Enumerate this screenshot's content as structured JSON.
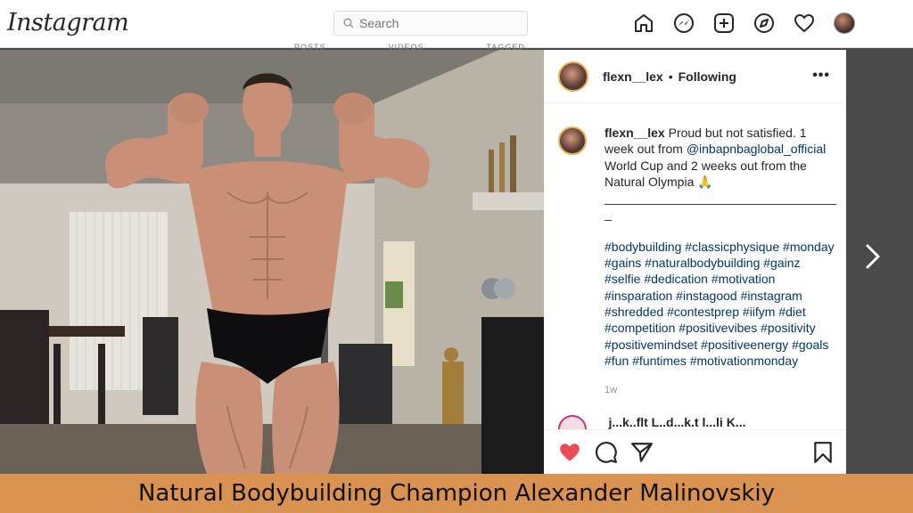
{
  "app": {
    "logo": "Instagram"
  },
  "search": {
    "placeholder": "Search"
  },
  "nav": {
    "icons": [
      "home-icon",
      "messenger-icon",
      "new-post-icon",
      "explore-icon",
      "activity-heart-icon",
      "profile-avatar"
    ]
  },
  "profile_tabs": [
    "POSTS",
    "VIDEOS",
    "TAGGED"
  ],
  "post": {
    "username": "flexn__lex",
    "separator": "•",
    "follow_status": "Following",
    "more": "•••",
    "caption_user": "flexn__lex",
    "caption_1": "Proud but not satisfied. 1 week out from ",
    "mention": "@inbapnbaglobal_official",
    "caption_2": " World Cup and 2 weeks out from the Natural Olympia 🙏",
    "divider": "____________________________________",
    "divider_end": "_",
    "hashtags": [
      "#bodybuilding",
      "#classicphysique",
      "#monday",
      "#gains",
      "#naturalbodybuilding",
      "#gainz",
      "#selfie",
      "#dedication",
      "#motivation",
      "#insparation",
      "#instagood",
      "#instagram",
      "#shredded",
      "#contestprep",
      "#iifym",
      "#diet",
      "#competition",
      "#positivevibes",
      "#positivity",
      "#positivemindset",
      "#positiveenergy",
      "#goals",
      "#fun",
      "#funtimes",
      "#motivationmonday"
    ],
    "age": "1w",
    "next_comment_preview": "j...k..flt  L..d...k.t l...li K..."
  },
  "colors": {
    "link": "#00376b",
    "like": "#ed4956",
    "banner": "#d9924f"
  },
  "banner": {
    "text": "Natural Bodybuilding Champion Alexander Malinovskiy"
  }
}
